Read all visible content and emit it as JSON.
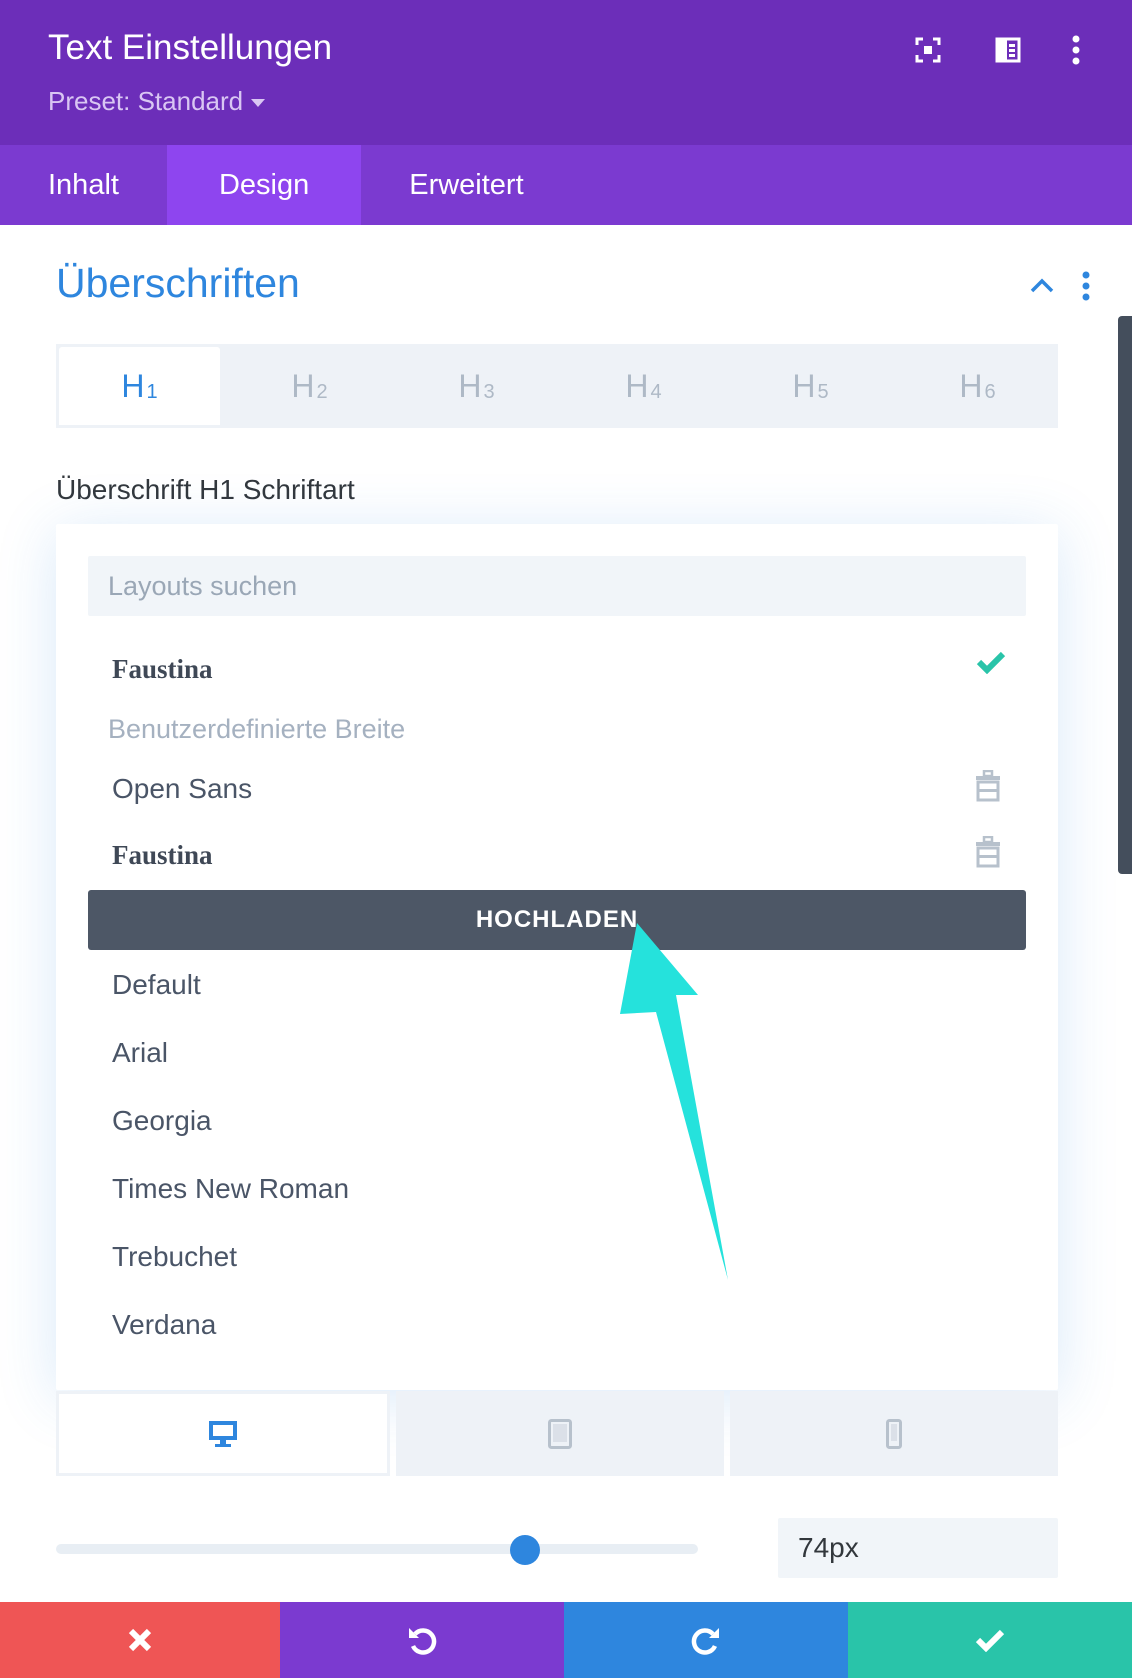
{
  "header": {
    "title": "Text Einstellungen",
    "preset": "Preset: Standard",
    "icons": [
      "focus-icon",
      "sidebar-layout-icon",
      "more-vertical-icon"
    ]
  },
  "tabs": [
    {
      "label": "Inhalt",
      "active": false
    },
    {
      "label": "Design",
      "active": true
    },
    {
      "label": "Erweitert",
      "active": false
    }
  ],
  "section": {
    "title": "Überschriften",
    "icons": [
      "chevron-up-icon",
      "more-vertical-icon"
    ]
  },
  "heading_levels": [
    {
      "letter": "H",
      "num": "1",
      "active": true
    },
    {
      "letter": "H",
      "num": "2",
      "active": false
    },
    {
      "letter": "H",
      "num": "3",
      "active": false
    },
    {
      "letter": "H",
      "num": "4",
      "active": false
    },
    {
      "letter": "H",
      "num": "5",
      "active": false
    },
    {
      "letter": "H",
      "num": "6",
      "active": false
    }
  ],
  "field_label": "Überschrift H1 Schriftart",
  "dropdown": {
    "search_placeholder": "Layouts suchen",
    "selected_font": "Faustina",
    "custom_group_label": "Benutzerdefinierte Breite",
    "custom_fonts": [
      "Open Sans",
      "Faustina"
    ],
    "upload_label": "HOCHLADEN",
    "default_fonts": [
      "Default",
      "Arial",
      "Georgia",
      "Times New Roman",
      "Trebuchet",
      "Verdana"
    ]
  },
  "devices": [
    "desktop-icon",
    "tablet-icon",
    "phone-icon"
  ],
  "slider": {
    "value": "74px",
    "fraction": 0.73
  },
  "footer_buttons": [
    {
      "name": "cancel-button",
      "icon": "close-icon",
      "color": "#ef5555"
    },
    {
      "name": "undo-button",
      "icon": "undo-icon",
      "color": "#7b3ad0"
    },
    {
      "name": "redo-button",
      "icon": "redo-icon",
      "color": "#2e86de"
    },
    {
      "name": "save-button",
      "icon": "check-icon",
      "color": "#29c4a9"
    }
  ],
  "colors": {
    "header": "#6c2eb9",
    "tabs": "#7b3ad0",
    "active_tab": "#8e45ef",
    "accent": "#2e86de",
    "arrow": "#25e2dc"
  }
}
